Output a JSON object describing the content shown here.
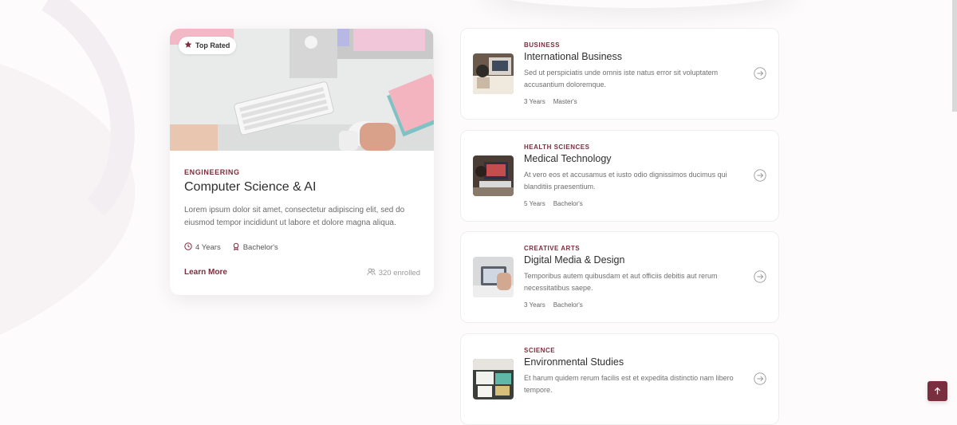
{
  "featured": {
    "badge": "Top Rated",
    "category": "ENGINEERING",
    "title": "Computer Science & AI",
    "description": "Lorem ipsum dolor sit amet, consectetur adipiscing elit, sed do eiusmod tempor incididunt ut labore et dolore magna aliqua.",
    "duration": "4 Years",
    "degree": "Bachelor's",
    "link_label": "Learn More",
    "enrolled": "320 enrolled",
    "icons": {
      "badge": "star-icon",
      "duration": "clock-icon",
      "degree": "award-icon",
      "enrolled": "users-icon"
    }
  },
  "programs": [
    {
      "category": "BUSINESS",
      "title": "International Business",
      "description": "Sed ut perspiciatis unde omnis iste natus error sit voluptatem accusantium doloremque.",
      "duration": "3 Years",
      "degree": "Master's"
    },
    {
      "category": "HEALTH SCIENCES",
      "title": "Medical Technology",
      "description": "At vero eos et accusamus et iusto odio dignissimos ducimus qui blanditiis praesentium.",
      "duration": "5 Years",
      "degree": "Bachelor's"
    },
    {
      "category": "CREATIVE ARTS",
      "title": "Digital Media & Design",
      "description": "Temporibus autem quibusdam et aut officiis debitis aut rerum necessitatibus saepe.",
      "duration": "3 Years",
      "degree": "Bachelor's"
    },
    {
      "category": "SCIENCE",
      "title": "Environmental Studies",
      "description": "Et harum quidem rerum facilis est et expedita distinctio nam libero tempore.",
      "duration": "",
      "degree": ""
    }
  ],
  "colors": {
    "accent": "#7b2e3e",
    "background": "#fdfbfc"
  },
  "scroll_to_top": {
    "icon": "arrow-up-icon"
  }
}
